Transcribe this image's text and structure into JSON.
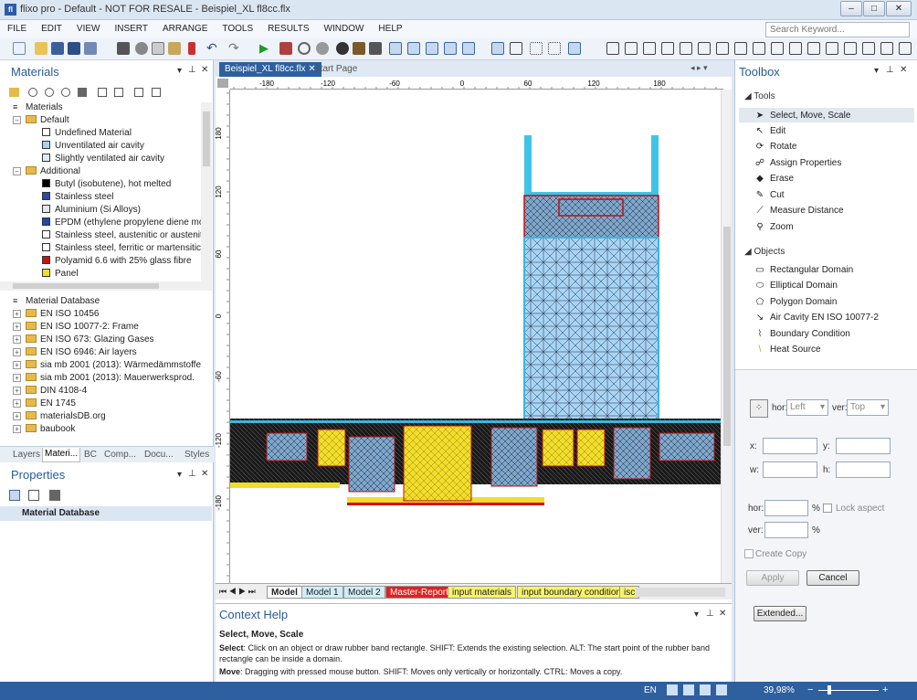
{
  "window": {
    "title": "flixo pro - Default - NOT FOR RESALE - Beispiel_XL fl8cc.flx"
  },
  "menu": [
    "FILE",
    "EDIT",
    "VIEW",
    "INSERT",
    "ARRANGE",
    "TOOLS",
    "RESULTS",
    "WINDOW",
    "HELP"
  ],
  "search": {
    "placeholder": "Search Keyword..."
  },
  "materials": {
    "title": "Materials",
    "root": "Materials",
    "default_group": "Default",
    "default_items": [
      {
        "label": "Undefined Material",
        "color": "#ffffff"
      },
      {
        "label": "Unventilated air cavity",
        "color": "#a8d4f0"
      },
      {
        "label": "Slightly ventilated air cavity",
        "color": "#d8eefa"
      }
    ],
    "additional_group": "Additional",
    "additional_items": [
      {
        "label": "Butyl (isobutene), hot melted",
        "color": "#000000"
      },
      {
        "label": "Stainless steel",
        "color": "#2c4aa0"
      },
      {
        "label": "Aluminium (Si Alloys)",
        "color": "#e8e8e8"
      },
      {
        "label": "EPDM (ethylene propylene diene mon",
        "color": "#2048b0"
      },
      {
        "label": "Stainless steel, austenitic or austenitic-",
        "color": "#ffffff"
      },
      {
        "label": "Stainless steel, ferritic or martensitic",
        "color": "#ffffff"
      },
      {
        "label": "Polyamid 6.6 with 25% glass fibre",
        "color": "#d01010"
      },
      {
        "label": "Panel",
        "color": "#f0e020"
      }
    ]
  },
  "database": {
    "title": "Material Database",
    "items": [
      "EN ISO 10456",
      "EN ISO 10077-2: Frame",
      "EN ISO 673: Glazing Gases",
      "EN ISO 6946: Air layers",
      "sia mb 2001 (2013): Wärmedämmstoffe",
      "sia mb 2001 (2013): Mauerwerksprod.",
      "DIN 4108-4",
      "EN 1745",
      "materialsDB.org",
      "baubook"
    ]
  },
  "left_tabs": [
    "Layers",
    "Materi...",
    "BC",
    "Comp...",
    "Docu...",
    "Styles"
  ],
  "properties": {
    "title": "Properties",
    "row": "Material Database"
  },
  "doc_tabs": {
    "active": "Beispiel_XL fl8cc.flx",
    "other": "Start Page"
  },
  "ruler": {
    "top": [
      "-180",
      "-120",
      "-60",
      "0",
      "60",
      "120",
      "180"
    ],
    "left": [
      "180",
      "120",
      "60",
      "0",
      "-60",
      "-120",
      "-180"
    ]
  },
  "sheets": [
    "Model",
    "Model 1",
    "Model 2",
    "Master-Report",
    "input materials",
    "input boundary conditions",
    "isc"
  ],
  "context_help": {
    "title": "Context Help",
    "heading": "Select, Move, Scale",
    "select_label": "Select",
    "select_text": ": Click on an object or draw rubber band rectangle. SHIFT: Extends the existing selection. ALT: The start point of the rubber band rectangle can be inside a domain.",
    "move_label": "Move",
    "move_text": ": Dragging with pressed mouse button. SHIFT: Moves only vertically or horizontally. CTRL: Moves a copy."
  },
  "toolbox": {
    "title": "Toolbox",
    "tools_header": "Tools",
    "tools": [
      {
        "label": "Select, Move, Scale",
        "icon": "arrow-icon"
      },
      {
        "label": "Edit",
        "icon": "edit-arrow-icon"
      },
      {
        "label": "Rotate",
        "icon": "rotate-icon"
      },
      {
        "label": "Assign Properties",
        "icon": "assign-icon"
      },
      {
        "label": "Erase",
        "icon": "eraser-icon"
      },
      {
        "label": "Cut",
        "icon": "knife-icon"
      },
      {
        "label": "Measure Distance",
        "icon": "ruler-icon"
      },
      {
        "label": "Zoom",
        "icon": "magnifier-icon"
      }
    ],
    "objects_header": "Objects",
    "objects": [
      {
        "label": "Rectangular Domain",
        "icon": "rectangle-icon"
      },
      {
        "label": "Elliptical Domain",
        "icon": "ellipse-icon"
      },
      {
        "label": "Polygon Domain",
        "icon": "polygon-icon"
      },
      {
        "label": "Air Cavity EN ISO 10077-2",
        "icon": "air-cavity-icon"
      },
      {
        "label": "Boundary Condition",
        "icon": "boundary-icon"
      },
      {
        "label": "Heat Source",
        "icon": "heat-source-icon"
      }
    ],
    "hor_label": "hor:",
    "hor_value": "Left",
    "ver_label": "ver:",
    "ver_value": "Top",
    "x_label": "x:",
    "y_label": "y:",
    "w_label": "w:",
    "h_label": "h:",
    "scale_hor": "hor:",
    "scale_ver": "ver:",
    "pct": "%",
    "lock_aspect": "Lock aspect",
    "create_copy": "Create Copy",
    "apply": "Apply",
    "cancel": "Cancel",
    "extended": "Extended..."
  },
  "status": {
    "lang": "EN",
    "zoom": "39,98%"
  },
  "colors": {
    "accent": "#2e5f9e",
    "mesh_blue": "#a8d4f5",
    "mesh_yellow": "#f2dd2a",
    "mesh_red": "#d01010"
  }
}
